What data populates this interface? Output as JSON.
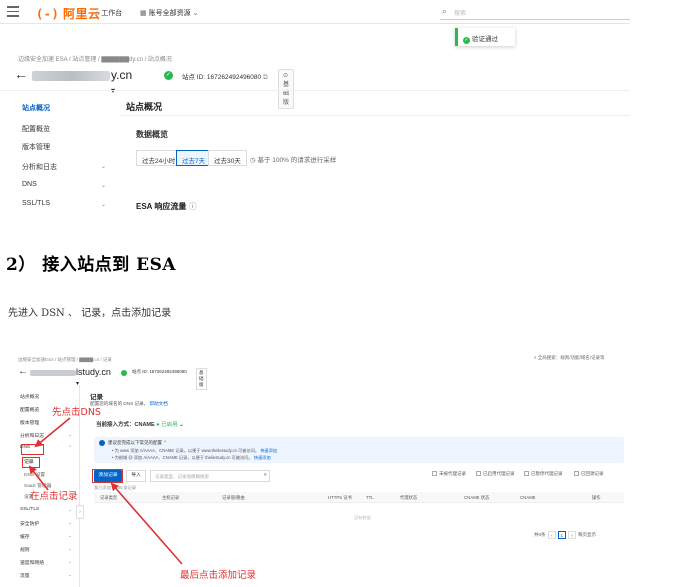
{
  "top_screenshot": {
    "logo": {
      "bracket": "(-)",
      "name": "阿里云"
    },
    "nav": {
      "workbench": "工作台",
      "account_resources": "账号全部资源"
    },
    "search": {
      "placeholder": "搜索"
    },
    "verify_toast": "验证通过",
    "breadcrumb": "边缘安全加速 ESA  /  站点管理  /  ▇▇▇▇▇▇dy.cn  /  站点概况",
    "site": {
      "domain_suffix": "y.cn",
      "site_id": "站点 ID: 167262492496080",
      "plan": "基础版"
    },
    "sidebar": [
      {
        "label": "站点概况",
        "active": true,
        "expandable": false
      },
      {
        "label": "配置概览",
        "active": false,
        "expandable": false
      },
      {
        "label": "版本管理",
        "active": false,
        "expandable": false
      },
      {
        "label": "分析和日志",
        "active": false,
        "expandable": true
      },
      {
        "label": "DNS",
        "active": false,
        "expandable": true
      },
      {
        "label": "SSL/TLS",
        "active": false,
        "expandable": true
      }
    ],
    "main": {
      "title": "站点概况",
      "section": "数据概览",
      "ranges": [
        "过去24小时",
        "过去7天",
        "过去30天"
      ],
      "selected_range": "过去7天",
      "sample_note": "基于 100% 的请求进行采样",
      "traffic_title": "ESA 响应流量"
    }
  },
  "article": {
    "heading": "2） 接入站点到 ESA",
    "paragraph": "先进入 DSN 、 记录，点击添加记录"
  },
  "bottom_screenshot": {
    "breadcrumb": "边缘安全加速ESA  /  站点管理  /  ▇▇▇▇.cn  /  记录",
    "global_search": "全局搜索：规则/功能/域名/记录等",
    "site": {
      "domain_suffix": "lstudy.cn",
      "site_id": "站点 ID: 167262492496080",
      "plan": "基础版"
    },
    "sidebar": [
      {
        "label": "站点概况",
        "type": "item"
      },
      {
        "label": "配置概览",
        "type": "item"
      },
      {
        "label": "版本管理",
        "type": "item"
      },
      {
        "label": "分析和日志",
        "type": "group"
      },
      {
        "label": "DNS",
        "type": "group"
      },
      {
        "label": "记录",
        "type": "active-sub"
      },
      {
        "label": "DNS 设置",
        "type": "sub"
      },
      {
        "label": "SaaS 管理器",
        "type": "sub"
      },
      {
        "label": "设置",
        "type": "sub"
      },
      {
        "label": "SSL/TLS",
        "type": "group"
      },
      {
        "label": "安全防护",
        "type": "group"
      },
      {
        "label": "缓存",
        "type": "group"
      },
      {
        "label": "规则",
        "type": "group"
      },
      {
        "label": "速度和网络",
        "type": "group"
      },
      {
        "label": "流量",
        "type": "group"
      }
    ],
    "page_title": "记录",
    "subtitle": "配置您的域名的 DNS 记录。",
    "subtitle_link": "帮助文档",
    "access_mode": "当前接入方式：CNAME",
    "access_mode_status": "已启用",
    "banner": {
      "title": "建议您完成以下常见的配置",
      "line1": "为 www 添加 A/AAAA、CNAME 记录，以便于 www.theliestudy.cn 可被访问。",
      "line2": "为根域 @ 添加 A/AAAA、CNAME 记录，以便于 theliestudy.cn 可被访问。",
      "link": "快速添加"
    },
    "add_record_button": "添加记录",
    "import_button": "导入",
    "filter_placeholder": "记录类型、记录值模糊搜索",
    "filters": [
      "未被代理记录",
      "已启用代理记录",
      "已暂停代理记录",
      "已回源记录"
    ],
    "added_count": "我已添加 0/100 条记录",
    "columns": [
      "记录类型",
      "主机记录",
      "记录值/路由",
      "HTTPS 证书",
      "TTL",
      "代理状态",
      "CNAME 状态",
      "CNAME",
      "操作"
    ],
    "empty_text": "没有数据",
    "pagination": {
      "total": "共0条",
      "current": "1",
      "per_page": "每页显示"
    }
  },
  "annotations": {
    "step1": "先点击DNS",
    "step2": "在点击记录",
    "step3": "最后点击添加记录",
    "color": "#e03131"
  }
}
